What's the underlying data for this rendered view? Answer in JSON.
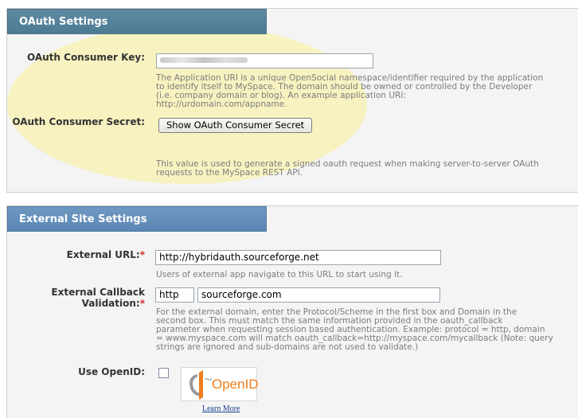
{
  "oauth": {
    "title": "OAuth Settings",
    "consumer_key_label": "OAuth Consumer Key:",
    "consumer_key_value": "",
    "consumer_key_help": [
      "The Application URI is a unique OpenSocial namespace/identifier required by the application",
      "to identify itself to MySpace. The domain should be owned or controlled by the Developer",
      "(i.e. company domain or blog). An example application URI:",
      "http://urdomain.com/appname."
    ],
    "consumer_secret_label": "OAuth Consumer Secret:",
    "show_secret_button": "Show OAuth Consumer Secret",
    "consumer_secret_help": [
      "This value is used to generate a signed oauth request when making server-to-server OAuth",
      "requests to the MySpace REST API."
    ]
  },
  "external": {
    "title": "External Site Settings",
    "url_label": "External URL:",
    "required_mark": "*",
    "url_value": "http://hybridauth.sourceforge.net",
    "url_help": "Users of external app navigate to this URL to start using it.",
    "callback_label_line1": "External Callback",
    "callback_label_line2": "Validation:",
    "protocol_value": "http",
    "domain_value": "sourceforge.com",
    "callback_help": [
      "For the external domain, enter the Protocol/Scheme in the first box and Domain in the",
      "second box. This must match the same information provided in the oauth_callback",
      "parameter when requesting session based authentication. Example: protocol = http, domain",
      "= www.myspace.com will match oauth_callback=http://myspace.com/mycallback (Note: query",
      "strings are ignored and sub-domains are not used to validate.)"
    ],
    "openid_label": "Use OpenID:",
    "openid_checked": false,
    "openid_logo_text": "OpenID",
    "learn_more": "Learn More"
  },
  "colors": {
    "oauth_header": "#5c8aa2",
    "external_header": "#6f98c2",
    "highlight": "#faf096",
    "required": "#cc2a2a",
    "openid_orange": "#f07c1b"
  }
}
